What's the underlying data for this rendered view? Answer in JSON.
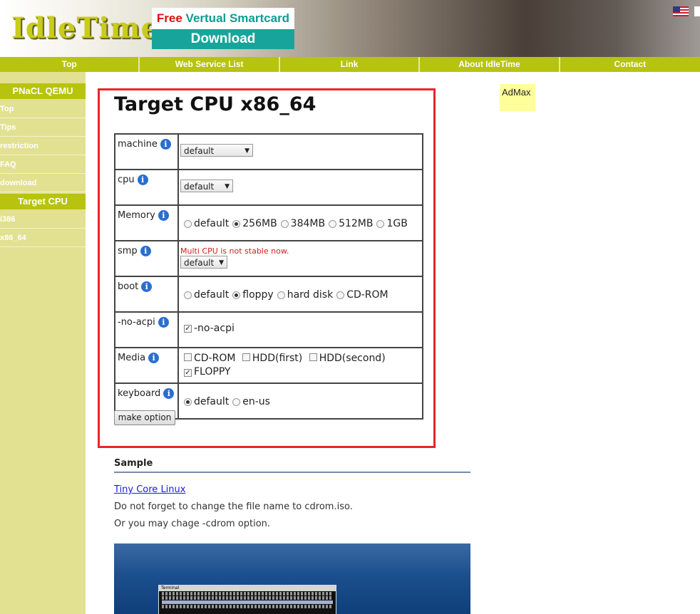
{
  "header": {
    "logo": "IdleTime",
    "banner_free": "Free",
    "banner_rest": " Vertual Smartcard",
    "banner_download": "Download",
    "flag_icon": "us-flag-icon"
  },
  "nav": [
    "Top",
    "Web Service List",
    "Link",
    "About IdleTime",
    "Contact"
  ],
  "sidebar": {
    "section1": "PNaCL QEMU",
    "items1": [
      "Top",
      "Tips",
      "restriction",
      "FAQ",
      "download"
    ],
    "section2": "Target CPU",
    "items2": [
      "i386",
      "x86_64"
    ]
  },
  "main": {
    "title": "Target CPU x86_64",
    "options": {
      "machine": {
        "label": "machine",
        "value": "default"
      },
      "cpu": {
        "label": "cpu",
        "value": "default"
      },
      "memory": {
        "label": "Memory",
        "choices": [
          "default",
          "256MB",
          "384MB",
          "512MB",
          "1GB"
        ],
        "selected": "256MB"
      },
      "smp": {
        "label": "smp",
        "warning": "Multi CPU is not stable now.",
        "value": "default"
      },
      "boot": {
        "label": "boot",
        "choices": [
          "default",
          "floppy",
          "hard disk",
          "CD-ROM"
        ],
        "selected": "floppy"
      },
      "noacpi": {
        "label": "-no-acpi",
        "check_label": "-no-acpi",
        "checked": true
      },
      "media": {
        "label": "Media",
        "choices": [
          "CD-ROM",
          "HDD(first)",
          "HDD(second)",
          "FLOPPY"
        ],
        "checked": [
          "FLOPPY"
        ]
      },
      "keyboard": {
        "label": "keyboard",
        "choices": [
          "default",
          "en-us"
        ],
        "selected": "default"
      }
    },
    "info_icon": "i",
    "make_button": "make option",
    "admax": "AdMax",
    "sample_heading": "Sample",
    "sample_link": "Tiny Core Linux",
    "sample_text1": "Do not forget to change the file name to cdrom.iso.",
    "sample_text2": "Or you may chage -cdrom option.",
    "terminal_title": "Terminal"
  },
  "colors": {
    "nav": "#b6c40e",
    "sidebar": "#e2e192",
    "panel_border": "#e8262a",
    "banner": "#17a59b"
  }
}
